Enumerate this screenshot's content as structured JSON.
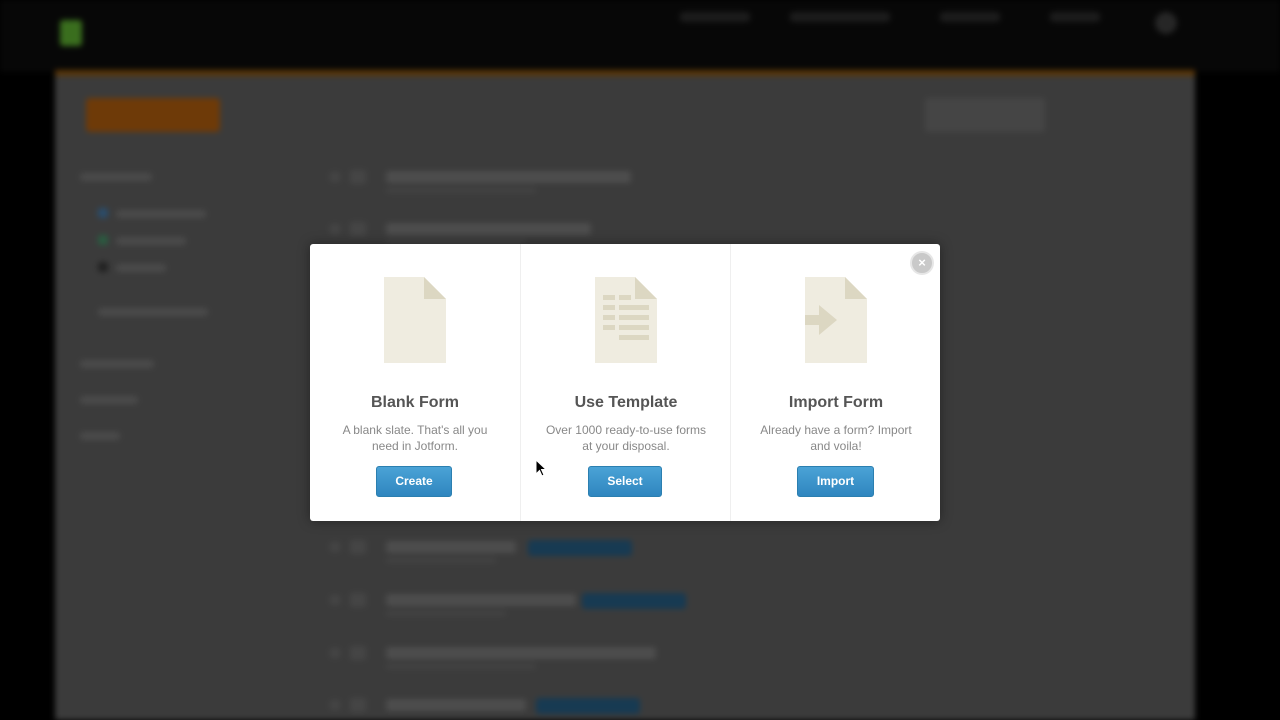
{
  "colors": {
    "button_blue": "#3a94cc",
    "icon_fill": "#efece0",
    "icon_detail": "#dcd7c2",
    "modal_bg": "#ffffff"
  },
  "modal": {
    "close_label": "×",
    "options": [
      {
        "title": "Blank Form",
        "description": "A blank slate. That's all you need in Jotform.",
        "button_label": "Create",
        "icon": "blank-document-icon"
      },
      {
        "title": "Use Template",
        "description": "Over 1000 ready-to-use forms at your disposal.",
        "button_label": "Select",
        "icon": "template-document-icon"
      },
      {
        "title": "Import Form",
        "description": "Already have a form? Import and voila!",
        "button_label": "Import",
        "icon": "import-document-icon"
      }
    ]
  }
}
